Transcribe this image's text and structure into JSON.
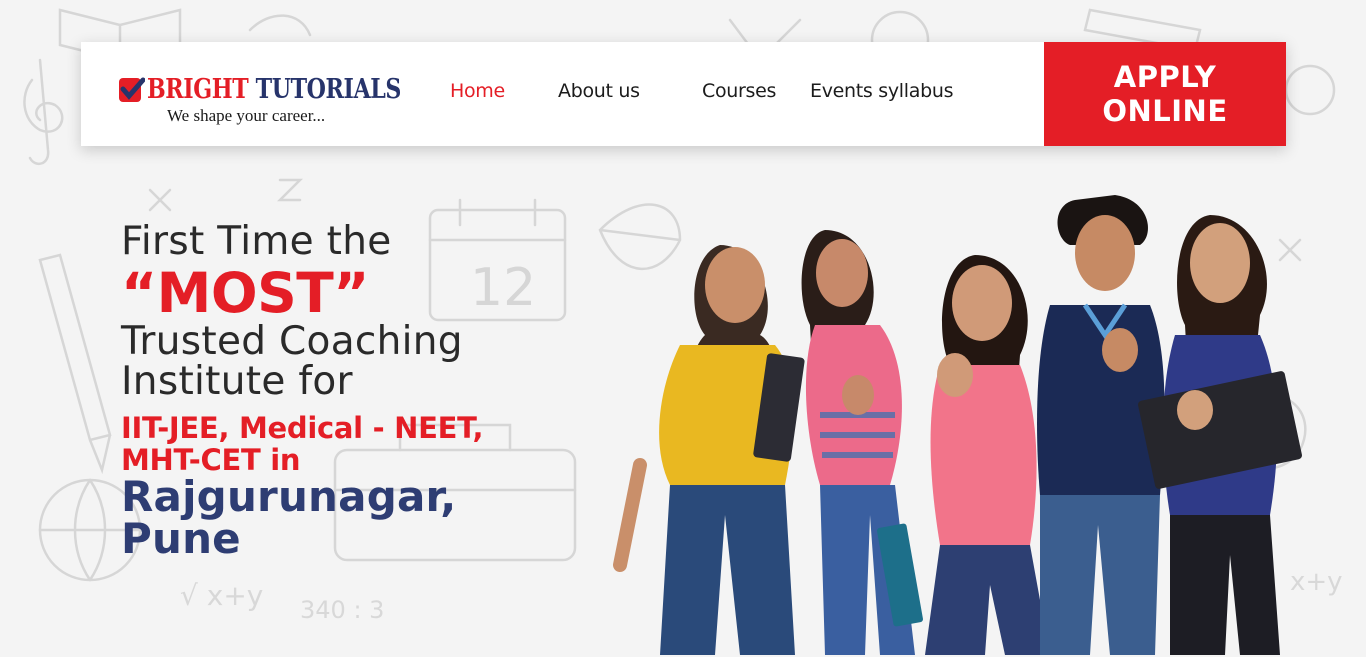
{
  "brand": {
    "name_part1": "BRIGHT",
    "name_part2": "TUTORIALS",
    "tagline": "We shape your career...",
    "colors": {
      "red": "#e41e26",
      "navy": "#27346b"
    }
  },
  "nav": {
    "items": [
      {
        "label": "Home",
        "active": true
      },
      {
        "label": "About us",
        "active": false
      },
      {
        "label": "Courses",
        "active": false
      },
      {
        "label": "Events syllabus",
        "active": false
      }
    ]
  },
  "cta": {
    "line1": "APPLY",
    "line2": "ONLINE"
  },
  "hero": {
    "line1": "First Time the",
    "highlight": "“MOST”",
    "line3a": "Trusted Coaching",
    "line3b": "Institute for",
    "courses_line1": "IIT-JEE, Medical - NEET,",
    "courses_line2": "MHT-CET in",
    "location_line1": "Rajgurunagar,",
    "location_line2": "Pune"
  },
  "images": {
    "students": "five-smiling-students-photo",
    "background": "school-doodle-sketch-pattern"
  }
}
